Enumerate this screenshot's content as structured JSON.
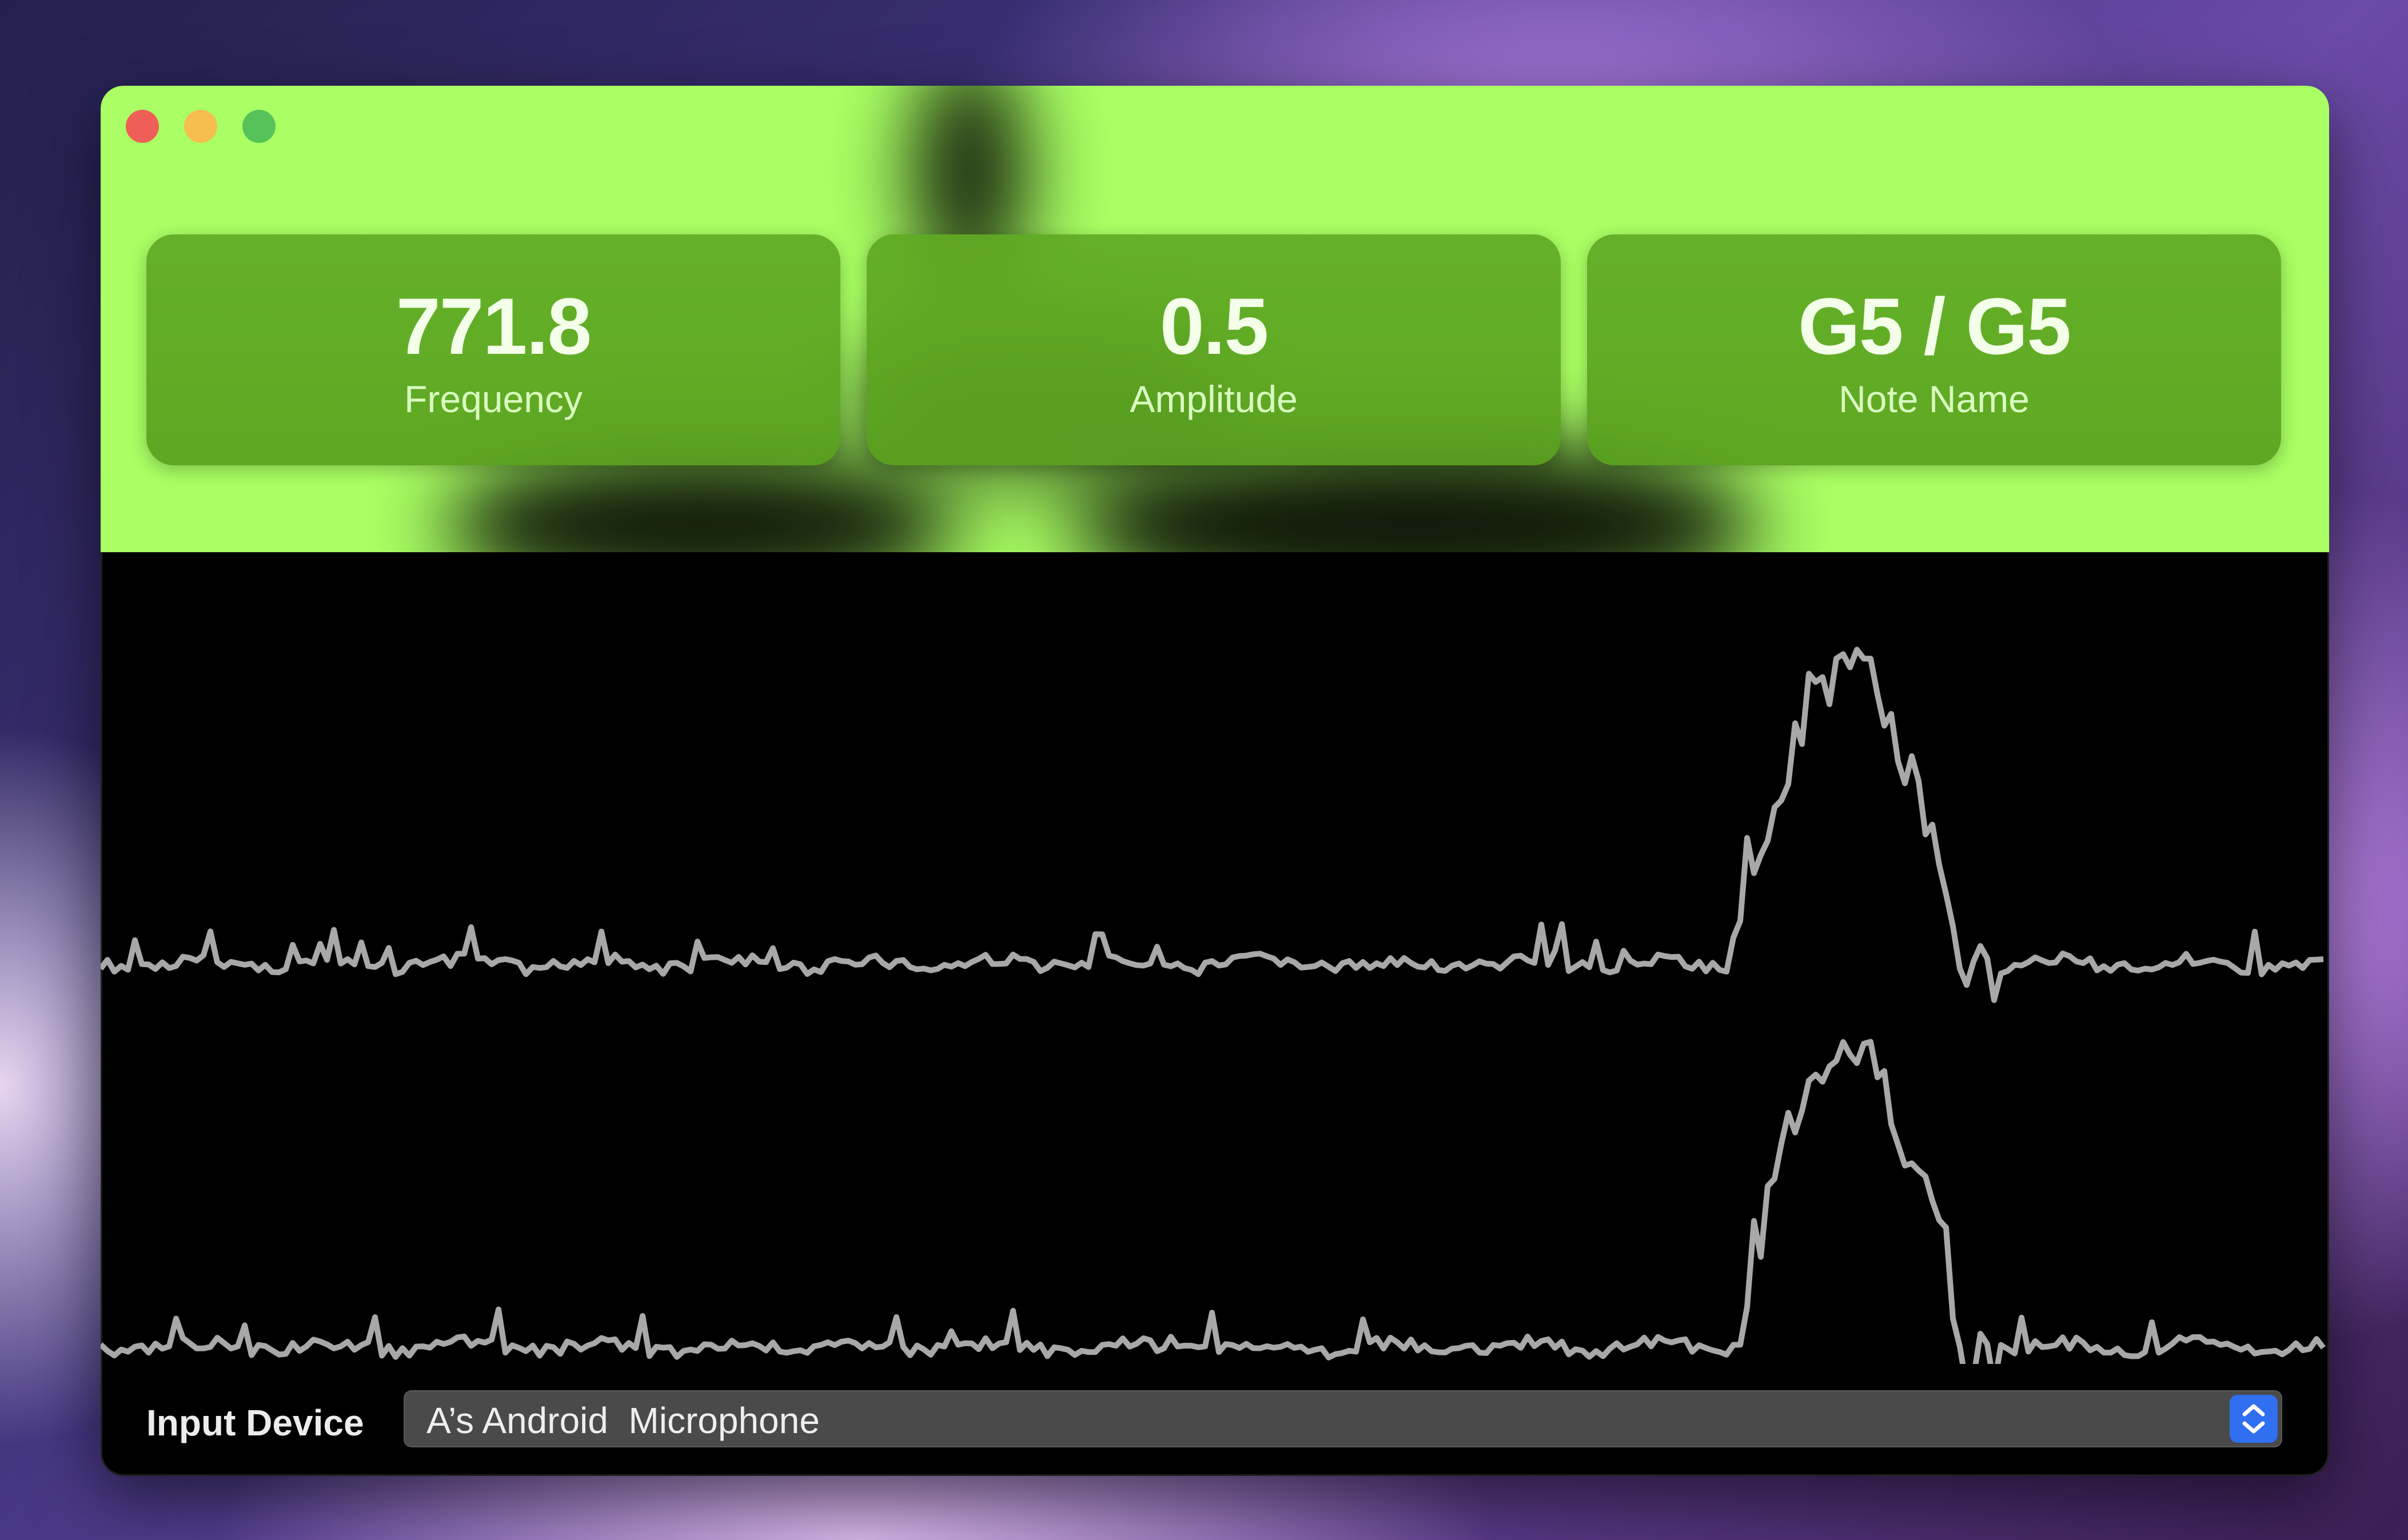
{
  "window": {
    "controls": [
      "close",
      "minimize",
      "maximize"
    ],
    "accent_color": "#a9ff63",
    "card_color": "#5fa823"
  },
  "stats": [
    {
      "value": "771.8",
      "label": "Frequency"
    },
    {
      "value": "0.5",
      "label": "Amplitude"
    },
    {
      "value": "G5 / G5",
      "label": "Note Name"
    }
  ],
  "waveform": {
    "channels": 2,
    "line_color": "#a8a8a8"
  },
  "footer": {
    "input_label": "Input Device",
    "selected_device": "A’s Android  Microphone",
    "stepper_icon": "chevron-up-down-icon"
  }
}
